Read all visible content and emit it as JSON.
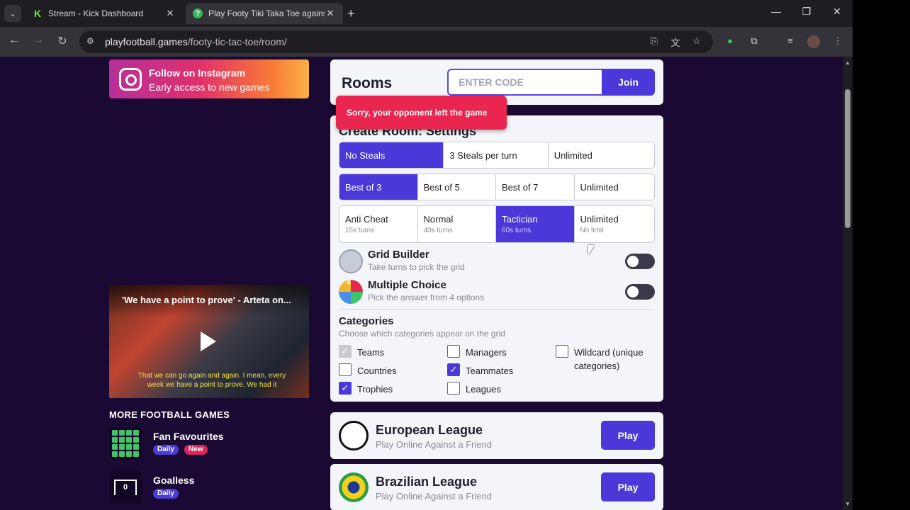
{
  "browser": {
    "tabs": [
      {
        "title": "Stream - Kick Dashboard",
        "favicon": "kick-icon",
        "active": false
      },
      {
        "title": "Play Footy Tiki Taka Toe against",
        "favicon": "play-football-icon",
        "active": true
      }
    ],
    "url_host": "playfootball.games",
    "url_path": "/footy-tic-tac-toe/room/"
  },
  "sidebar": {
    "instagram_title": "Follow on Instagram",
    "instagram_sub": "Early access to new games",
    "video_title": "'We have a point to prove' - Arteta on...",
    "video_subtitle": "That we can go again and again. I mean, every week we have a point to prove. We had it",
    "more_title": "MORE FOOTBALL GAMES",
    "games": [
      {
        "name": "Fan Favourites",
        "badges": [
          "Daily",
          "New"
        ]
      },
      {
        "name": "Goalless",
        "badges": [
          "Daily"
        ],
        "icon_text": "0"
      }
    ]
  },
  "rooms": {
    "title": "Rooms",
    "code_placeholder": "ENTER CODE",
    "join_label": "Join"
  },
  "toast": "Sorry, your opponent left the game",
  "settings": {
    "title": "Create Room: Settings",
    "steals": [
      "No Steals",
      "3 Steals per turn",
      "Unlimited"
    ],
    "rounds": [
      "Best of 3",
      "Best of 5",
      "Best of 7",
      "Unlimited"
    ],
    "timers": [
      {
        "label": "Anti Cheat",
        "sub": "15s turns"
      },
      {
        "label": "Normal",
        "sub": "40s turns"
      },
      {
        "label": "Tactician",
        "sub": "60s turns"
      },
      {
        "label": "Unlimited",
        "sub": "No limit"
      }
    ],
    "grid_builder": {
      "title": "Grid Builder",
      "sub": "Take turns to pick the grid",
      "enabled": false
    },
    "multiple_choice": {
      "title": "Multiple Choice",
      "sub": "Pick the answer from 4 options",
      "enabled": false,
      "icon_text": "4"
    },
    "categories_title": "Categories",
    "categories_sub": "Choose which categories appear on the grid",
    "categories": {
      "teams": {
        "label": "Teams",
        "checked": true,
        "disabled": true
      },
      "managers": {
        "label": "Managers",
        "checked": false
      },
      "wildcard": {
        "label": "Wildcard (unique categories)",
        "checked": false
      },
      "countries": {
        "label": "Countries",
        "checked": false
      },
      "teammates": {
        "label": "Teammates",
        "checked": true
      },
      "trophies": {
        "label": "Trophies",
        "checked": true
      },
      "leagues": {
        "label": "Leagues",
        "checked": false
      }
    }
  },
  "leagues": [
    {
      "name": "European League",
      "sub": "Play Online Against a Friend",
      "button": "Play"
    },
    {
      "name": "Brazilian League",
      "sub": "Play Online Against a Friend",
      "button": "Play"
    }
  ],
  "colors": {
    "accent": "#4a38d8",
    "page_bg": "#1a0932",
    "toast": "#e8264f"
  }
}
